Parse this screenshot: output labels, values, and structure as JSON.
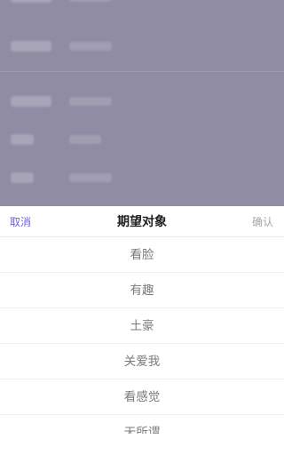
{
  "sheet": {
    "title": "期望对象",
    "cancel_label": "取消",
    "confirm_label": "确认",
    "options": [
      "看脸",
      "有趣",
      "土豪",
      "关爱我",
      "看感觉",
      "无所谓"
    ]
  },
  "colors": {
    "overlay": "#8f8ca3",
    "cancel": "#6c61d9",
    "confirm": "#a6a6ad",
    "option_text": "#7a7a7a"
  }
}
